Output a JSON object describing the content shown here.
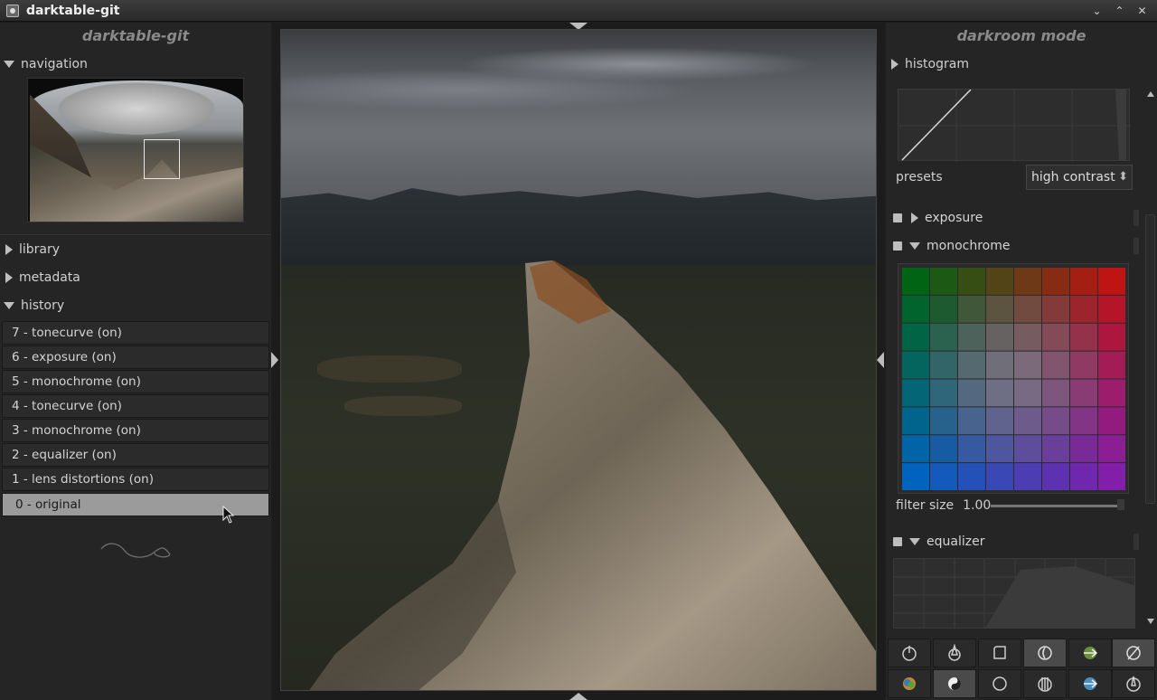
{
  "window": {
    "title": "darktable-git",
    "controls": [
      "minimize-icon",
      "maximize-icon",
      "close-icon"
    ]
  },
  "left_panel": {
    "header": "darktable-git",
    "navigation": {
      "label": "navigation",
      "expanded": true
    },
    "library": {
      "label": "library",
      "expanded": false
    },
    "metadata": {
      "label": "metadata",
      "expanded": false
    },
    "history": {
      "label": "history",
      "expanded": true,
      "items": [
        "7 - tonecurve (on)",
        "6 - exposure (on)",
        "5 - monochrome (on)",
        "4 - tonecurve (on)",
        "3 - monochrome (on)",
        "2 - equalizer (on)",
        "1 - lens distortions (on)",
        "0 - original"
      ],
      "selected_index": 7
    }
  },
  "right_panel": {
    "header": "darkroom mode",
    "histogram": {
      "label": "histogram",
      "expanded": false
    },
    "presets": {
      "label": "presets",
      "value": "high contrast"
    },
    "modules": [
      {
        "label": "exposure",
        "expanded": false
      },
      {
        "label": "monochrome",
        "expanded": true
      },
      {
        "label": "equalizer",
        "expanded": true
      }
    ],
    "filter": {
      "label": "filter size",
      "value": "1.00"
    },
    "module_groups": {
      "row1": [
        "basic-group-icon",
        "tone-group-icon",
        "crop-group-icon",
        "color-group-icon",
        "correction-group-icon",
        "effect-group-icon"
      ],
      "row2": [
        "color-balance-icon",
        "yin-yang-icon",
        "circle-icon",
        "levels-icon",
        "effects-icon",
        "sharpen-icon"
      ],
      "active_row1": [
        3,
        5
      ],
      "active_row2": [
        1
      ]
    }
  },
  "colors": {
    "background": "#1e1e1e",
    "panel": "#252525",
    "selected_history": "#9b9b9b",
    "text": "#cfcfcf"
  }
}
